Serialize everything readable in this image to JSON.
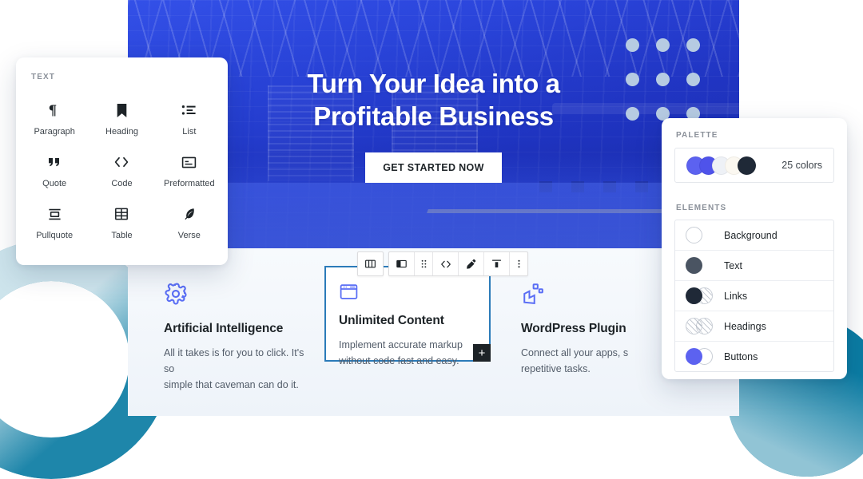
{
  "colors": {
    "accent_blue": "#2747e0",
    "brand_indigo": "#5a6ef5",
    "selection_border": "#2b7bb9",
    "teal": "#0b7ca3",
    "dot_blue": "#b6cbe2",
    "panel_bg": "#ffffff",
    "canvas_bg": "#f4f7fb"
  },
  "hero": {
    "title_line1": "Turn Your Idea into a",
    "title_line2": "Profitable Business",
    "cta_label": "GET STARTED NOW"
  },
  "features": [
    {
      "icon": "gear-icon",
      "title": "Artificial Intelligence",
      "desc_line1": "All it takes is for you to click. It's so",
      "desc_line2": "simple that caveman can do it.",
      "selected": false
    },
    {
      "icon": "browser-window-icon",
      "title": "Unlimited Content",
      "desc_line1": "Implement accurate markup",
      "desc_line2": "without code fast and easy.",
      "selected": true,
      "add_badge": "+"
    },
    {
      "icon": "plugin-blocks-icon",
      "title": "WordPress Plugin",
      "desc_line1": "Connect all your apps, s",
      "desc_line2": "repetitive tasks.",
      "selected": false
    }
  ],
  "block_toolbar": {
    "buttons": [
      {
        "name": "columns-block-icon",
        "tooltip": "Columns"
      },
      {
        "name": "media-text-icon",
        "tooltip": "Change block type"
      },
      {
        "name": "drag-handle-icon",
        "tooltip": "Drag"
      },
      {
        "name": "code-brackets-icon",
        "tooltip": "Edit as HTML"
      },
      {
        "name": "paintbrush-icon",
        "tooltip": "Styles"
      },
      {
        "name": "align-top-icon",
        "tooltip": "Vertical align top"
      },
      {
        "name": "more-options-icon",
        "tooltip": "Options"
      }
    ]
  },
  "text_panel": {
    "label": "TEXT",
    "blocks": [
      {
        "icon": "paragraph-pilcrow-icon",
        "label": "Paragraph"
      },
      {
        "icon": "heading-bookmark-icon",
        "label": "Heading"
      },
      {
        "icon": "list-icon",
        "label": "List"
      },
      {
        "icon": "quote-icon",
        "label": "Quote"
      },
      {
        "icon": "code-brackets-icon",
        "label": "Code"
      },
      {
        "icon": "preformatted-icon",
        "label": "Preformatted"
      },
      {
        "icon": "pullquote-icon",
        "label": "Pullquote"
      },
      {
        "icon": "table-icon",
        "label": "Table"
      },
      {
        "icon": "verse-feather-icon",
        "label": "Verse"
      }
    ]
  },
  "palette_panel": {
    "palette_label": "PALETTE",
    "palette_count": "25 colors",
    "palette_swatches": [
      "#5c62f0",
      "#4f53ea",
      "#eef1f6",
      "#fbf8f1",
      "#1f2937"
    ],
    "elements_label": "ELEMENTS",
    "elements": [
      {
        "label": "Background",
        "swatch": "outline",
        "color_a": "#ffffff",
        "color_b": ""
      },
      {
        "label": "Text",
        "swatch": "solid",
        "color_a": "#4a5462",
        "color_b": ""
      },
      {
        "label": "Links",
        "swatch": "split",
        "color_a": "#1f2937",
        "color_b": "hatch"
      },
      {
        "label": "Headings",
        "swatch": "double-hatch",
        "color_a": "hatch",
        "color_b": "hatch"
      },
      {
        "label": "Buttons",
        "swatch": "split",
        "color_a": "#5c62f0",
        "color_b": "#ffffff"
      }
    ]
  }
}
